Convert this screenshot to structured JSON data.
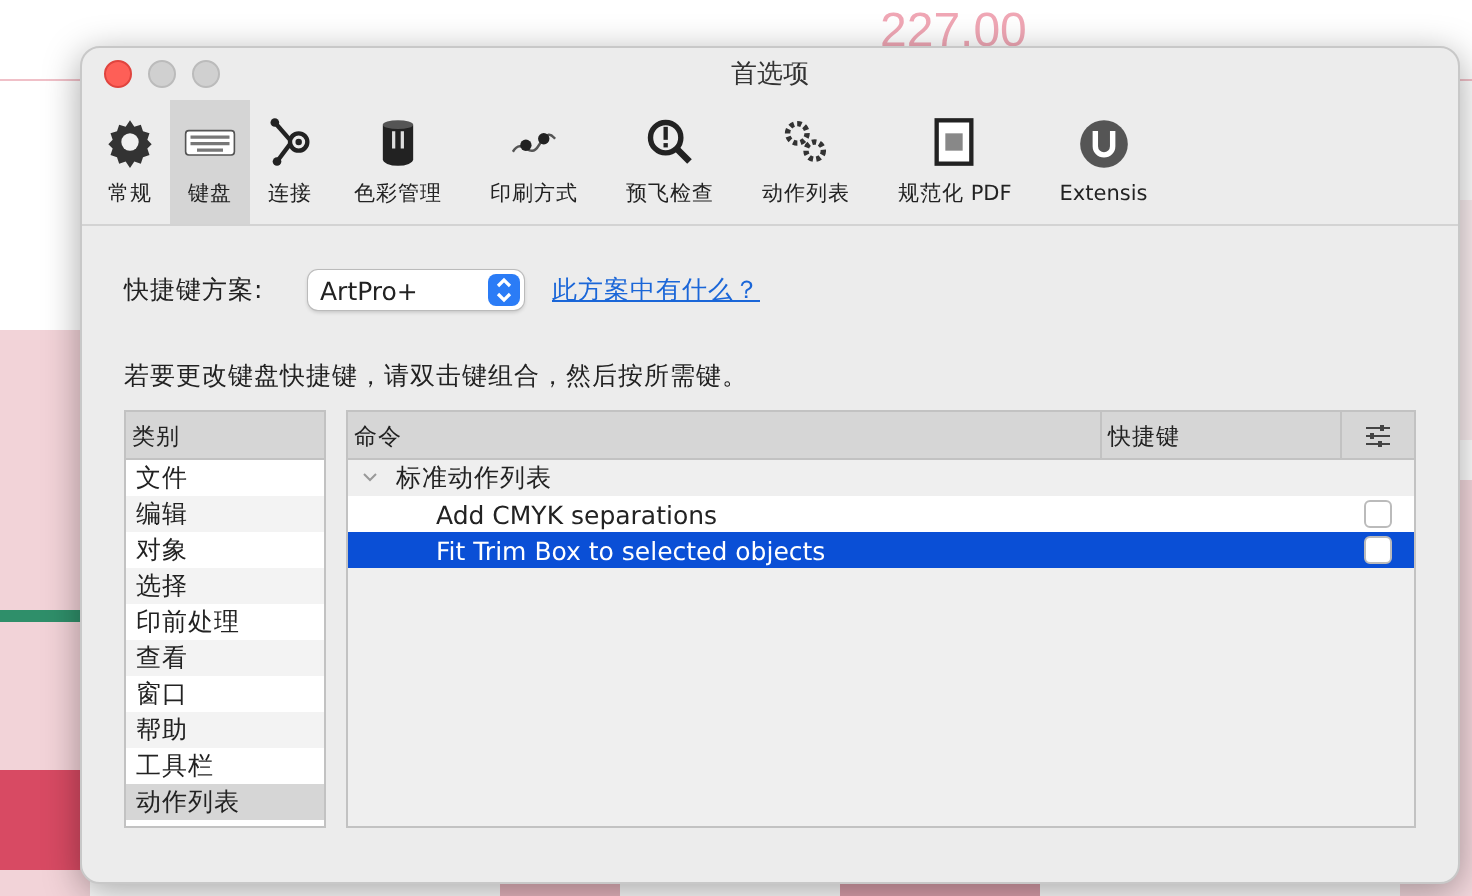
{
  "background": {
    "kind": "picture",
    "dimension": "227.00"
  },
  "window": {
    "title": "首选项"
  },
  "toolbar": [
    {
      "label": "常规",
      "selected": false
    },
    {
      "label": "键盘",
      "selected": true
    },
    {
      "label": "连接",
      "selected": false
    },
    {
      "label": "色彩管理",
      "selected": false
    },
    {
      "label": "印刷方式",
      "selected": false
    },
    {
      "label": "预飞检查",
      "selected": false
    },
    {
      "label": "动作列表",
      "selected": false
    },
    {
      "label": "规范化 PDF",
      "selected": false
    },
    {
      "label": "Extensis",
      "selected": false
    }
  ],
  "scheme": {
    "label": "快捷键方案:",
    "value": "ArtPro+",
    "link": "此方案中有什么？"
  },
  "instruction": "若要更改键盘快捷键，请双击键组合，然后按所需键。",
  "categories": {
    "header": "类别",
    "items": [
      {
        "label": "文件",
        "selected": false
      },
      {
        "label": "编辑",
        "selected": false
      },
      {
        "label": "对象",
        "selected": false
      },
      {
        "label": "选择",
        "selected": false
      },
      {
        "label": "印前处理",
        "selected": false
      },
      {
        "label": "查看",
        "selected": false
      },
      {
        "label": "窗口",
        "selected": false
      },
      {
        "label": "帮助",
        "selected": false
      },
      {
        "label": "工具栏",
        "selected": false
      },
      {
        "label": "动作列表",
        "selected": true
      }
    ]
  },
  "commands": {
    "columns": [
      "命令",
      "快捷键"
    ],
    "groups": [
      {
        "label": "标准动作列表",
        "expanded": true,
        "children": [
          {
            "label": "Add CMYK separations",
            "selected": false,
            "checked": false
          },
          {
            "label": "Fit Trim Box to selected objects",
            "selected": true,
            "checked": false
          }
        ]
      }
    ]
  }
}
